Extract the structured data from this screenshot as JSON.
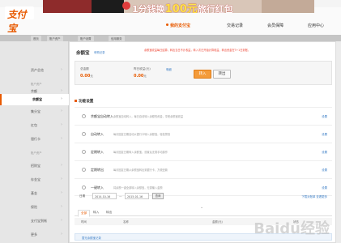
{
  "header": {
    "logo_text": "支付宝",
    "banner_text": "1分钱换",
    "banner_big": "100元",
    "banner_tail": "旅行红包"
  },
  "main_nav": [
    {
      "label": "我的支付宝",
      "active": true
    },
    {
      "label": "交易记录",
      "active": false
    },
    {
      "label": "会员保障",
      "active": false
    },
    {
      "label": "应用中心",
      "active": false
    }
  ],
  "sub_nav": [
    "首页",
    "账户资产",
    "账户设置",
    "信用服务"
  ],
  "sidebar": {
    "group1": "账户资产",
    "group2": "账户资产",
    "items": [
      {
        "label": "资产总览",
        "active": false
      },
      {
        "label": "余额",
        "active": false
      },
      {
        "label": "余额宝",
        "active": true
      },
      {
        "label": "集分宝",
        "active": false
      },
      {
        "label": "红包",
        "active": false
      },
      {
        "label": "银行卡",
        "active": false
      },
      {
        "label": "招财宝",
        "active": false
      },
      {
        "label": "存金宝",
        "active": false
      },
      {
        "label": "基金",
        "active": false
      },
      {
        "label": "保险",
        "active": false
      },
      {
        "label": "支付宝到帐",
        "active": false
      },
      {
        "label": "更多",
        "active": false
      }
    ]
  },
  "panel": {
    "title": "余额宝",
    "title_sub": "申购记录",
    "notice": "余额宝收益每日结算，转出当日不计收益，转入次日开始计算收益，转出资金在T+1日到账。",
    "balance": {
      "total_label": "总金额",
      "total_value": "0.00",
      "total_unit": "元",
      "yesterday_label": "昨日收益(元)",
      "yesterday_value": "0.00",
      "yesterday_unit": "元",
      "link": "明细",
      "transfer_in": "转入",
      "transfer_out": "转出"
    },
    "section_title": "功能设置",
    "functions": [
      {
        "name": "余额宝自动转入",
        "desc": "余额宝自动转入，每日自动转入余额的资金，享受余额宝收益",
        "action": "设置"
      },
      {
        "name": "自动转入",
        "desc": "每月固定日期自动从银行卡转入余额宝，轻松攒钱",
        "action": "设置"
      },
      {
        "name": "定期转入",
        "desc": "每月固定日期转入余额宝，设置后无需手动操作",
        "action": "设置"
      },
      {
        "name": "定期转出",
        "desc": "每月固定日期从余额宝转出到银行卡，方便还款",
        "action": "设置"
      },
      {
        "name": "一键转入",
        "desc": "将余额一键全部转入余额宝，无需输入金额",
        "action": "设置"
      }
    ],
    "filter": {
      "label": "日期",
      "date_from": "2014-10-16",
      "date_sep": "—",
      "date_to": "2015-01-16",
      "search": "查询",
      "more": "下载对账单 查看更多"
    },
    "tabs": [
      {
        "label": "全部",
        "on": true
      },
      {
        "label": "转入",
        "on": false
      },
      {
        "label": "转出",
        "on": false
      }
    ],
    "table_head": [
      "时间",
      "名称",
      "金额(元)",
      "状态"
    ],
    "table_info": "暂无余额宝记录"
  },
  "watermark": "Baidu经验"
}
